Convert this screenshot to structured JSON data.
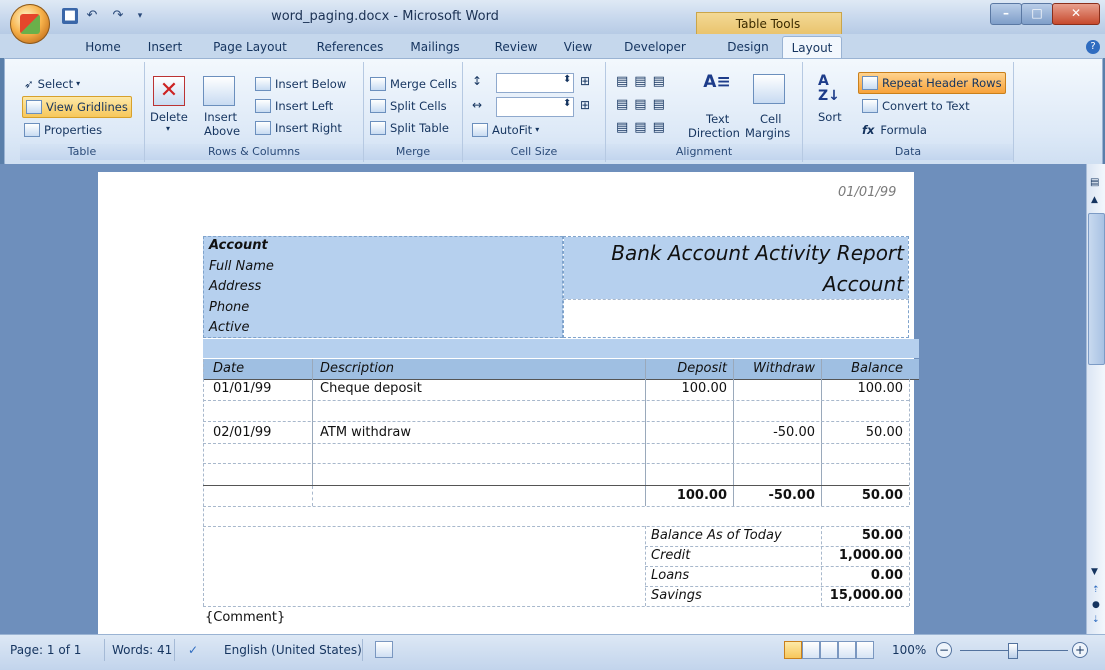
{
  "window": {
    "title": "word_paging.docx - Microsoft Word",
    "context_tab_group": "Table Tools"
  },
  "tabs": [
    "Home",
    "Insert",
    "Page Layout",
    "References",
    "Mailings",
    "Review",
    "View",
    "Developer",
    "Design",
    "Layout"
  ],
  "ribbon": {
    "table": {
      "label": "Table",
      "select": "Select",
      "view_gridlines": "View Gridlines",
      "properties": "Properties"
    },
    "rows_columns": {
      "label": "Rows & Columns",
      "delete": "Delete",
      "insert_above_1": "Insert",
      "insert_above_2": "Above",
      "insert_below": "Insert Below",
      "insert_left": "Insert Left",
      "insert_right": "Insert Right"
    },
    "merge": {
      "label": "Merge",
      "merge_cells": "Merge Cells",
      "split_cells": "Split Cells",
      "split_table": "Split Table"
    },
    "cell_size": {
      "label": "Cell Size",
      "autofit": "AutoFit"
    },
    "alignment": {
      "label": "Alignment",
      "text_direction_1": "Text",
      "text_direction_2": "Direction",
      "cell_margins_1": "Cell",
      "cell_margins_2": "Margins"
    },
    "data": {
      "label": "Data",
      "sort": "Sort",
      "repeat_header_rows": "Repeat Header Rows",
      "convert_to_text": "Convert to Text",
      "formula": "Formula"
    }
  },
  "document": {
    "date": "01/01/99",
    "header_left": [
      "Account",
      "Full Name",
      "Address",
      "Phone",
      "Active"
    ],
    "report_title_1": "Bank Account Activity Report",
    "report_title_2": "Account",
    "columns": [
      "Date",
      "Description",
      "Deposit",
      "Withdraw",
      "Balance"
    ],
    "rows": [
      {
        "date": "01/01/99",
        "description": "Cheque deposit",
        "deposit": "100.00",
        "withdraw": "",
        "balance": "100.00"
      },
      {
        "date": "02/01/99",
        "description": "ATM withdraw",
        "deposit": "",
        "withdraw": "-50.00",
        "balance": "50.00"
      }
    ],
    "totals": {
      "deposit": "100.00",
      "withdraw": "-50.00",
      "balance": "50.00"
    },
    "summary": [
      {
        "label": "Balance As of Today",
        "value": "50.00"
      },
      {
        "label": "Credit",
        "value": "1,000.00"
      },
      {
        "label": "Loans",
        "value": "0.00"
      },
      {
        "label": "Savings",
        "value": "15,000.00"
      }
    ],
    "comment": "{Comment}"
  },
  "status": {
    "page": "Page: 1 of 1",
    "words": "Words: 41",
    "language": "English (United States)",
    "zoom": "100%",
    "zoom_out": "−",
    "zoom_in": "+"
  }
}
